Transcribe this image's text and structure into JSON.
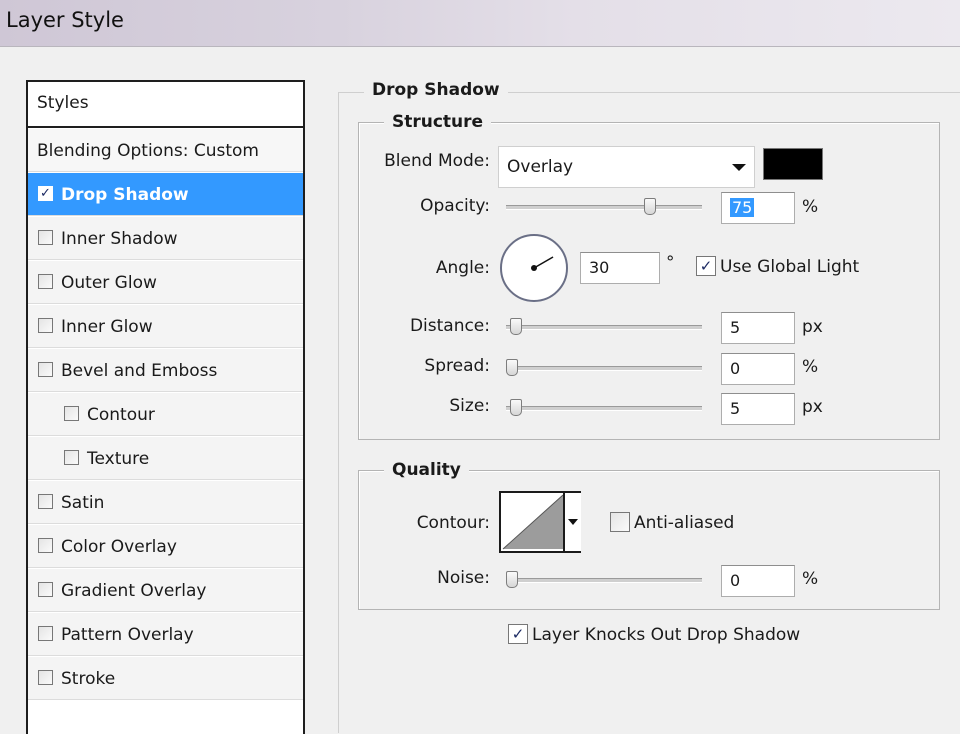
{
  "window": {
    "title": "Layer Style"
  },
  "styles_panel": {
    "header": "Styles",
    "items": [
      {
        "label": "Blending Options: Custom",
        "checkbox": false,
        "checked": false,
        "indent": false,
        "selected": false
      },
      {
        "label": "Drop Shadow",
        "checkbox": true,
        "checked": true,
        "indent": false,
        "selected": true
      },
      {
        "label": "Inner Shadow",
        "checkbox": true,
        "checked": false,
        "indent": false,
        "selected": false
      },
      {
        "label": "Outer Glow",
        "checkbox": true,
        "checked": false,
        "indent": false,
        "selected": false
      },
      {
        "label": "Inner Glow",
        "checkbox": true,
        "checked": false,
        "indent": false,
        "selected": false
      },
      {
        "label": "Bevel and Emboss",
        "checkbox": true,
        "checked": false,
        "indent": false,
        "selected": false
      },
      {
        "label": "Contour",
        "checkbox": true,
        "checked": false,
        "indent": true,
        "selected": false
      },
      {
        "label": "Texture",
        "checkbox": true,
        "checked": false,
        "indent": true,
        "selected": false
      },
      {
        "label": "Satin",
        "checkbox": true,
        "checked": false,
        "indent": false,
        "selected": false
      },
      {
        "label": "Color Overlay",
        "checkbox": true,
        "checked": false,
        "indent": false,
        "selected": false
      },
      {
        "label": "Gradient Overlay",
        "checkbox": true,
        "checked": false,
        "indent": false,
        "selected": false
      },
      {
        "label": "Pattern Overlay",
        "checkbox": true,
        "checked": false,
        "indent": false,
        "selected": false
      },
      {
        "label": "Stroke",
        "checkbox": true,
        "checked": false,
        "indent": false,
        "selected": false
      }
    ]
  },
  "drop_shadow": {
    "title": "Drop Shadow",
    "structure": {
      "title": "Structure",
      "blend_mode": {
        "label": "Blend Mode:",
        "value": "Overlay",
        "color": "#000000"
      },
      "opacity": {
        "label": "Opacity:",
        "value": "75",
        "unit": "%",
        "slider_fraction": 0.75
      },
      "angle": {
        "label": "Angle:",
        "value": "30",
        "unit": "°",
        "degrees": 30,
        "use_global_light": {
          "label": "Use Global Light",
          "checked": true
        }
      },
      "distance": {
        "label": "Distance:",
        "value": "5",
        "unit": "px",
        "slider_fraction": 0.02
      },
      "spread": {
        "label": "Spread:",
        "value": "0",
        "unit": "%",
        "slider_fraction": 0.0
      },
      "size": {
        "label": "Size:",
        "value": "5",
        "unit": "px",
        "slider_fraction": 0.02
      }
    },
    "quality": {
      "title": "Quality",
      "contour": {
        "label": "Contour:",
        "anti_aliased": {
          "label": "Anti-aliased",
          "checked": false
        }
      },
      "noise": {
        "label": "Noise:",
        "value": "0",
        "unit": "%",
        "slider_fraction": 0.0
      }
    },
    "knockout": {
      "label": "Layer Knocks Out Drop Shadow",
      "checked": true
    }
  },
  "colors": {
    "selection": "#3399ff",
    "check": "#1c2a63"
  }
}
